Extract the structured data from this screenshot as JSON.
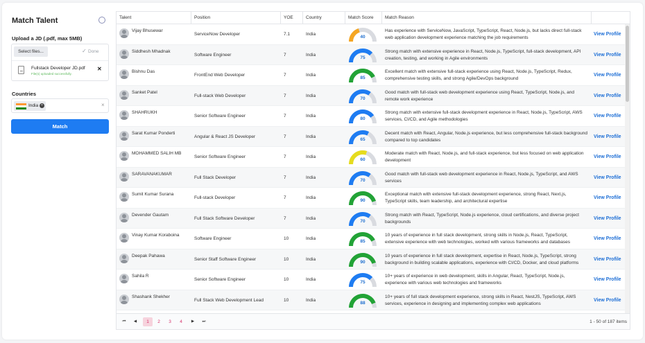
{
  "left_panel": {
    "title": "Match Talent",
    "upload_label": "Upload a JD (.pdf, max 5MB)",
    "select_files": "Select files...",
    "done_label": "Done",
    "file_name": "Fullstack Developer JD.pdf",
    "file_status": "File(s) uploaded successfully.",
    "countries_label": "Countries",
    "country_chip": "India",
    "match_button": "Match"
  },
  "table": {
    "columns": [
      "Talent",
      "Position",
      "YOE",
      "Country",
      "Match Score",
      "Match Reason",
      ""
    ],
    "view_label": "View Profile",
    "rows": [
      {
        "name": "Vijay Bhusewar",
        "position": "ServiceNow Developer",
        "yoe": "7.1",
        "country": "India",
        "score": 40,
        "reason": "Has experience with ServiceNow, JavaScript, TypeScript, React, Node.js, but lacks direct full-stack web application development experience matching the job requirements"
      },
      {
        "name": "Siddhesh Mhadnak",
        "position": "Software Engineer",
        "yoe": "7",
        "country": "India",
        "score": 75,
        "reason": "Strong match with extensive experience in React, Node.js, TypeScript, full-stack development, API creation, testing, and working in Agile environments"
      },
      {
        "name": "Bishnu Das",
        "position": "FrontEnd Web Developer",
        "yoe": "7",
        "country": "India",
        "score": 85,
        "reason": "Excellent match with extensive full-stack experience using React, Node.js, TypeScript, Redux, comprehensive testing skills, and strong Agile/DevOps background"
      },
      {
        "name": "Sanket Patel",
        "position": "Full-stack Web Developer",
        "yoe": "7",
        "country": "India",
        "score": 70,
        "reason": "Good match with full-stack web development experience using React, TypeScript, Node.js, and remote work experience"
      },
      {
        "name": "SHAHRUKH",
        "position": "Senior Software Engineer",
        "yoe": "7",
        "country": "India",
        "score": 80,
        "reason": "Strong match with extensive full-stack development experience in React, Node.js, TypeScript, AWS services, CI/CD, and Agile methodologies"
      },
      {
        "name": "Sarat Kumar Ponderti",
        "position": "Angular & React JS Developer",
        "yoe": "7",
        "country": "India",
        "score": 65,
        "reason": "Decent match with React, Angular, Node.js experience, but less comprehensive full-stack background compared to top candidates"
      },
      {
        "name": "MOHAMMED SALIH MB",
        "position": "Senior Software Engineer",
        "yoe": "7",
        "country": "India",
        "score": 60,
        "reason": "Moderate match with React, Node.js, and full-stack experience, but less focused on web application development"
      },
      {
        "name": "SARAVANAKUMAR",
        "position": "Full Stack Developer",
        "yoe": "7",
        "country": "India",
        "score": 70,
        "reason": "Good match with full-stack web development experience in React, Node.js, TypeScript, and AWS services"
      },
      {
        "name": "Sumit Kumar Surana",
        "position": "Full-stack Developer",
        "yoe": "7",
        "country": "India",
        "score": 90,
        "reason": "Exceptional match with extensive full-stack development experience, strong React, Next.js, TypeScript skills, team leadership, and architectural expertise"
      },
      {
        "name": "Devender Gautam",
        "position": "Full Stack Software Developer",
        "yoe": "7",
        "country": "India",
        "score": 70,
        "reason": "Strong match with React, TypeScript, Node.js experience, cloud certifications, and diverse project backgrounds"
      },
      {
        "name": "Vinay Kumar Koraboina",
        "position": "Software Engineer",
        "yoe": "10",
        "country": "India",
        "score": 85,
        "reason": "10 years of experience in full stack development, strong skills in Node.js, React, TypeScript, extensive experience with web technologies, worked with various frameworks and databases"
      },
      {
        "name": "Deepak Pahawa",
        "position": "Senior Staff Software Engineer",
        "yoe": "10",
        "country": "India",
        "score": 90,
        "reason": "10 years of experience in full stack development, expertise in React, Node.js, TypeScript, strong background in building scalable applications, experience with CI/CD, Docker, and cloud platforms"
      },
      {
        "name": "Sahila R",
        "position": "Senior Software Engineer",
        "yoe": "10",
        "country": "India",
        "score": 75,
        "reason": "10+ years of experience in web development, skills in Angular, React, TypeScript, Node.js, experience with various web technologies and frameworks"
      },
      {
        "name": "Shashank Shekher",
        "position": "Full Stack Web Development Lead",
        "yoe": "10",
        "country": "India",
        "score": 88,
        "reason": "10+ years of full stack development experience, strong skills in React, NestJS, TypeScript, AWS services, experience in designing and implementing complex web applications"
      }
    ]
  },
  "pager": {
    "first": "⏮",
    "prev": "◀",
    "pages": [
      "1",
      "2",
      "3",
      "4"
    ],
    "active_page": "1",
    "next": "▶",
    "last": "⏭",
    "items_label": "1 - 50 of 187 items"
  },
  "colors": {
    "accent": "#1e7cf2",
    "gauge_orange": "#f5a623",
    "gauge_yellow": "#e6dc1e",
    "gauge_blue": "#1e7cf2",
    "gauge_green": "#22a336",
    "gauge_track": "#d9dbe0"
  }
}
